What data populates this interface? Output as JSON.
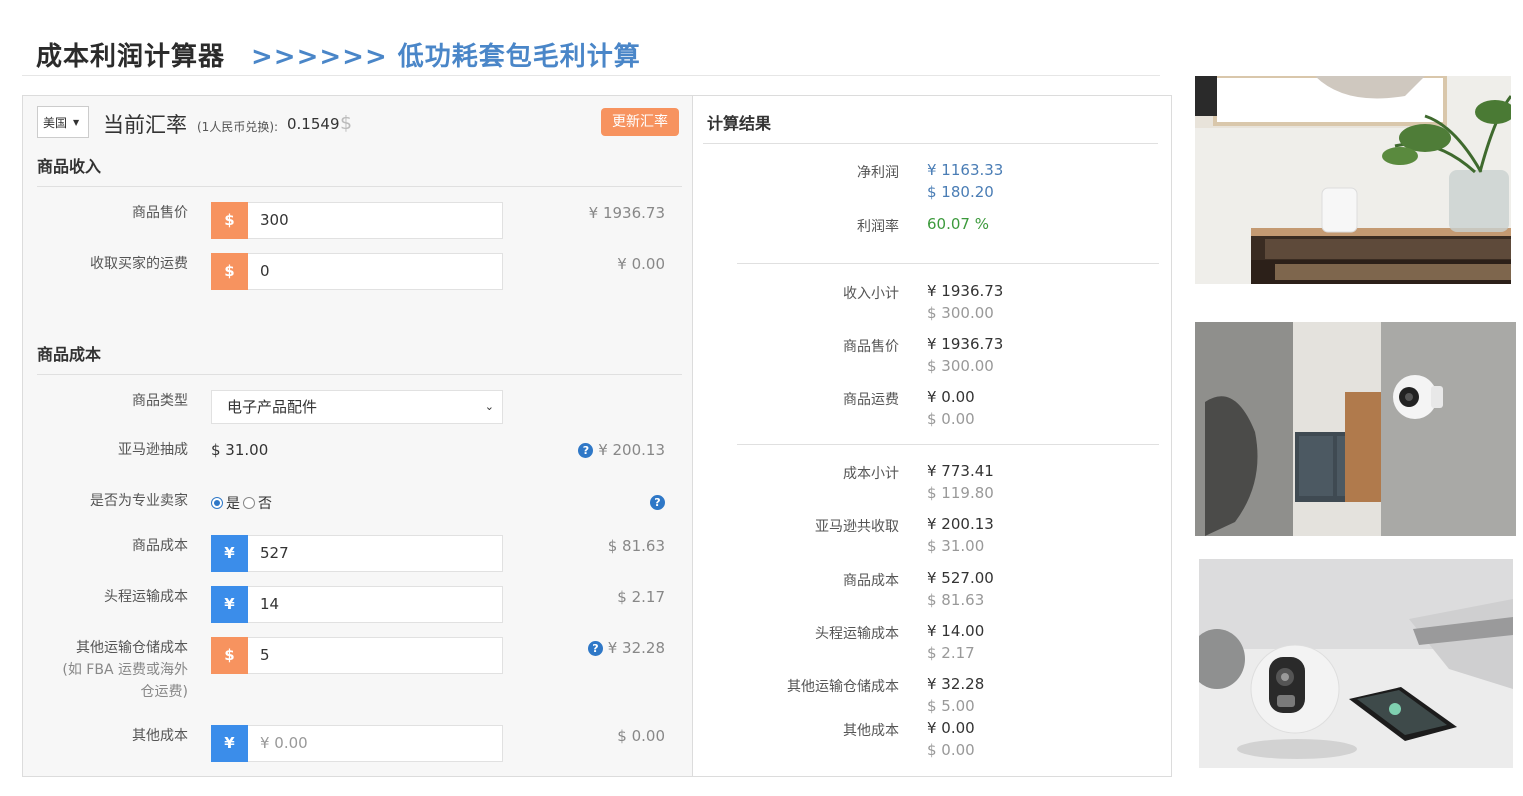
{
  "header": {
    "title": "成本利润计算器",
    "subtitle": ">>>>>> 低功耗套包毛利计算"
  },
  "topbar": {
    "country": "美国",
    "rate_title": "当前汇率",
    "rate_sub": "(1人民币兑换):",
    "rate_value": "0.1549",
    "rate_symbol": "$",
    "update_button": "更新汇率"
  },
  "income": {
    "section": "商品收入",
    "rows": [
      {
        "label": "商品售价",
        "currency": "$",
        "value": "300",
        "converted": "¥ 1936.73"
      },
      {
        "label": "收取买家的运费",
        "currency": "$",
        "value": "0",
        "converted": "¥ 0.00"
      }
    ]
  },
  "cost": {
    "section": "商品成本",
    "type_label": "商品类型",
    "type_value": "电子产品配件",
    "commission_label": "亚马逊抽成",
    "commission_value": "$ 31.00",
    "commission_converted": "¥ 200.13",
    "pro_label": "是否为专业卖家",
    "pro_yes": "是",
    "pro_no": "否",
    "rows": [
      {
        "label": "商品成本",
        "currency": "¥",
        "value": "527",
        "converted": "$ 81.63"
      },
      {
        "label": "头程运输成本",
        "currency": "¥",
        "value": "14",
        "converted": "$ 2.17"
      },
      {
        "label": "其他运输仓储成本",
        "note1": "(如 FBA 运费或海外",
        "note2": "仓运费)",
        "currency": "$",
        "value": "5",
        "converted": "¥ 32.28"
      },
      {
        "label": "其他成本",
        "currency": "¥",
        "placeholder": "¥ 0.00",
        "converted": "$ 0.00"
      }
    ]
  },
  "results": {
    "title": "计算结果",
    "net_profit_label": "净利润",
    "net_profit_cny": "¥ 1163.33",
    "net_profit_usd": "$ 180.20",
    "margin_label": "利润率",
    "margin_value": "60.07 %",
    "items": [
      {
        "label": "收入小计",
        "cny": "¥ 1936.73",
        "usd": "$ 300.00"
      },
      {
        "label": "商品售价",
        "cny": "¥ 1936.73",
        "usd": "$ 300.00"
      },
      {
        "label": "商品运费",
        "cny": "¥ 0.00",
        "usd": "$ 0.00"
      },
      {
        "label": "成本小计",
        "cny": "¥ 773.41",
        "usd": "$ 119.80"
      },
      {
        "label": "亚马逊共收取",
        "cny": "¥ 200.13",
        "usd": "$ 31.00"
      },
      {
        "label": "商品成本",
        "cny": "¥ 527.00",
        "usd": "$ 81.63"
      },
      {
        "label": "头程运输成本",
        "cny": "¥ 14.00",
        "usd": "$ 2.17"
      },
      {
        "label": "其他运输仓储成本",
        "cny": "¥ 32.28",
        "usd": "$ 5.00"
      },
      {
        "label": "其他成本",
        "cny": "¥ 0.00",
        "usd": "$ 0.00"
      }
    ]
  },
  "icons": {
    "help": "help-icon",
    "dropdown": "chevron-down-icon"
  }
}
